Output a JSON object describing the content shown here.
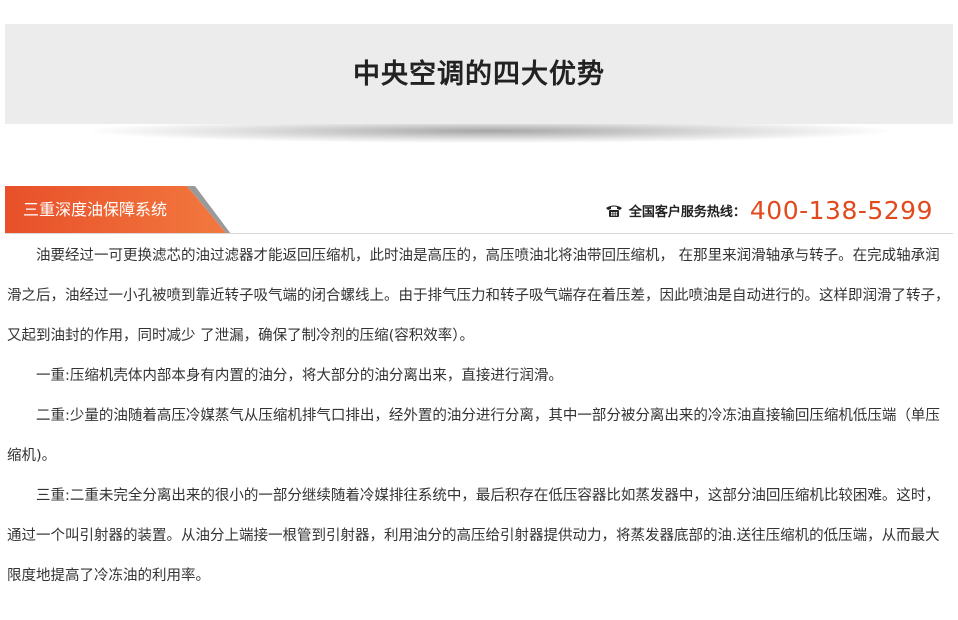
{
  "hero": {
    "title": "中央空调的四大优势"
  },
  "section": {
    "tab_label": "三重深度油保障系统",
    "hotline_label": "全国客户服务热线：",
    "hotline_number": "400-138-5299",
    "phone_icon": "telephone-icon"
  },
  "colors": {
    "accent": "#e04a1d",
    "tab_gradient_start": "#e8502a",
    "tab_gradient_end": "#f2793f",
    "hero_bg": "#ececec"
  },
  "paragraphs": [
    "油要经过一可更换滤芯的油过滤器才能返回压缩机，此时油是高压的，高压喷油北将油带回压缩机， 在那里来润滑轴承与转子。在完成轴承润滑之后，油经过一小孔被喷到靠近转子吸气端的闭合螺线上。由于排气压力和转子吸气端存在着压差，因此喷油是自动进行的。这样即润滑了转子，又起到油封的作用，同时减少 了泄漏，确保了制冷剂的压缩(容积效率）。",
    "一重:压缩机壳体内部本身有内置的油分，将大部分的油分离出来，直接进行润滑。",
    "二重:少量的油随着高压冷媒蒸气从压缩机排气口排出，经外置的油分进行分离，其中一部分被分离出来的冷冻油直接输回压缩机低压端（单压缩机)。",
    "三重:二重未完全分离出来的很小的一部分继续随着冷媒排往系统中，最后积存在低压容器比如蒸发器中，这部分油回压缩机比较困难。这时，通过一个叫引射器的装置。从油分上端接一根管到引射器，利用油分的高压给引射器提供动力，将蒸发器底部的油.送往压缩机的低压端，从而最大限度地提高了冷冻油的利用率。"
  ]
}
